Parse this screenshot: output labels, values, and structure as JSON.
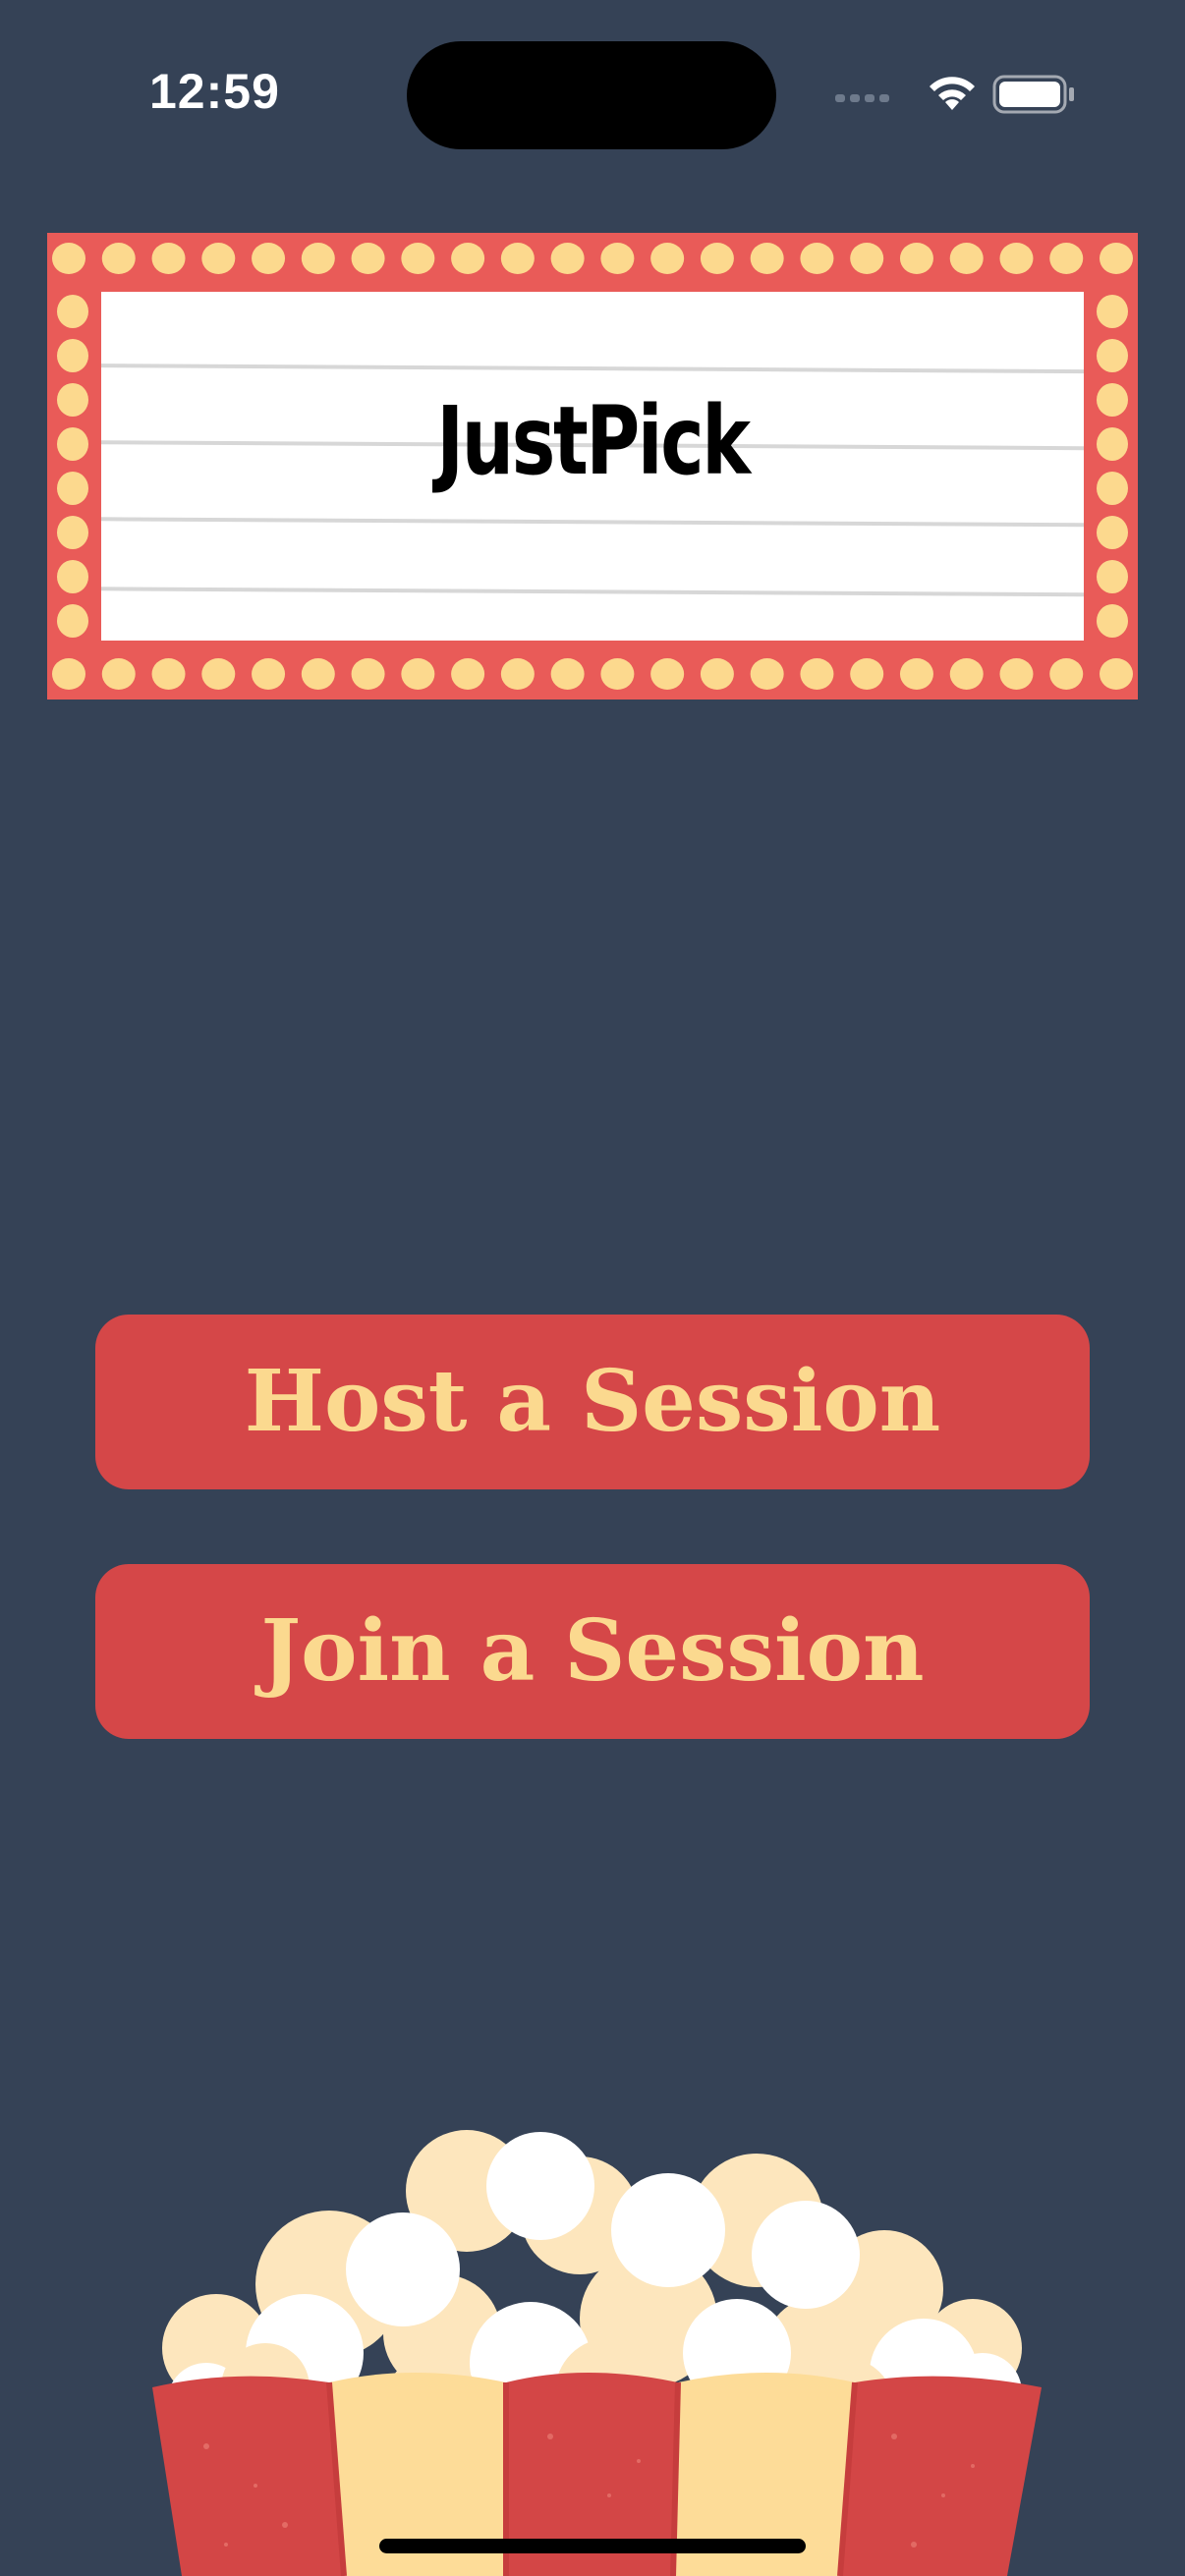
{
  "status_bar": {
    "time": "12:59",
    "icons": [
      "cellular-signal-icon",
      "wifi-icon",
      "battery-icon"
    ]
  },
  "marquee": {
    "title": "JustPick",
    "colors": {
      "frame": "#e95b58",
      "bulb": "#fcd98e",
      "board": "#ffffff",
      "line": "#d7d7d7"
    }
  },
  "buttons": {
    "host_label": "Host a Session",
    "join_label": "Join a Session"
  },
  "theme": {
    "background": "#354256",
    "button_bg": "#d54748",
    "button_text": "#fbd98f"
  },
  "decor": {
    "illustration": "popcorn-bucket"
  }
}
